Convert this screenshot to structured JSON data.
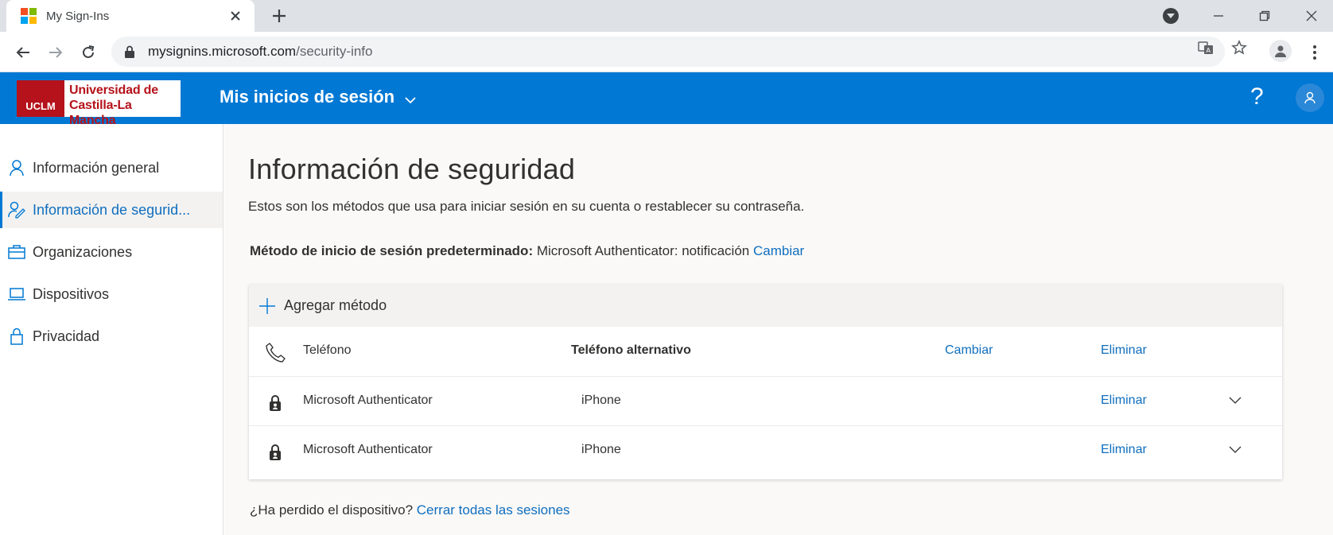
{
  "browser": {
    "tab_title": "My Sign-Ins",
    "url_host": "mysignins.microsoft.com",
    "url_path": "/security-info"
  },
  "app": {
    "logo_line1": "Universidad de",
    "logo_line2": "Castilla-La Mancha",
    "logo_abbr": "UCLM",
    "title": "Mis inicios de sesión",
    "help_label": "?"
  },
  "sidebar": {
    "items": [
      {
        "label": "Información general",
        "icon": "person-icon"
      },
      {
        "label": "Información de segurid...",
        "icon": "security-info-icon"
      },
      {
        "label": "Organizaciones",
        "icon": "briefcase-icon"
      },
      {
        "label": "Dispositivos",
        "icon": "laptop-icon"
      },
      {
        "label": "Privacidad",
        "icon": "lock-icon"
      }
    ]
  },
  "main": {
    "title": "Información de seguridad",
    "subtitle": "Estos son los métodos que usa para iniciar sesión en su cuenta o restablecer su contraseña.",
    "default_label": "Método de inicio de sesión predeterminado:",
    "default_value": " Microsoft Authenticator: notificación ",
    "default_change": "Cambiar",
    "add_method": "Agregar método",
    "methods": [
      {
        "name": "Teléfono",
        "detail": "Teléfono alternativo",
        "change": "Cambiar",
        "delete": "Eliminar",
        "icon": "phone-icon"
      },
      {
        "name": "Microsoft Authenticator",
        "detail": "iPhone",
        "delete": "Eliminar",
        "icon": "authenticator-icon"
      },
      {
        "name": "Microsoft Authenticator",
        "detail": "iPhone",
        "delete": "Eliminar",
        "icon": "authenticator-icon"
      }
    ],
    "lost_question": "¿Ha perdido el dispositivo? ",
    "lost_link": "Cerrar todas las sesiones"
  },
  "colors": {
    "brand_blue": "#0078d4",
    "link_blue": "#106ebe",
    "uclm_red": "#b5121b"
  }
}
